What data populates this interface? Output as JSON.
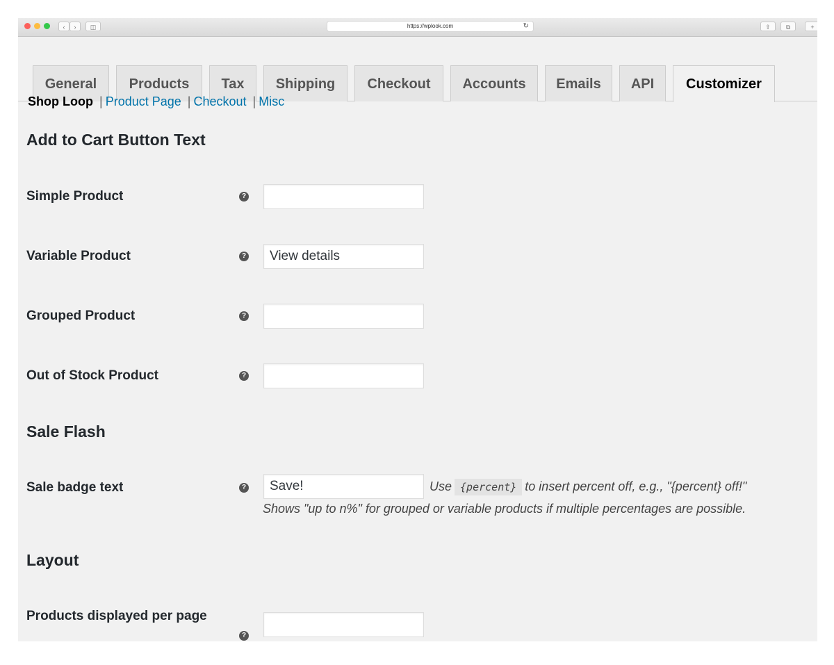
{
  "browser": {
    "url": "https://wplook.com",
    "colors": {
      "close": "#fc605b",
      "minimize": "#fdbc40",
      "zoom": "#34c84a"
    }
  },
  "tabs": [
    {
      "label": "General"
    },
    {
      "label": "Products"
    },
    {
      "label": "Tax"
    },
    {
      "label": "Shipping"
    },
    {
      "label": "Checkout"
    },
    {
      "label": "Accounts"
    },
    {
      "label": "Emails"
    },
    {
      "label": "API"
    },
    {
      "label": "Customizer",
      "active": true
    }
  ],
  "subnav": {
    "current": "Shop Loop",
    "links": [
      "Product Page",
      "Checkout",
      "Misc"
    ],
    "separator": "|"
  },
  "sections": {
    "add_to_cart": {
      "title": "Add to Cart Button Text",
      "fields": [
        {
          "label": "Simple Product",
          "value": ""
        },
        {
          "label": "Variable Product",
          "value": "View details"
        },
        {
          "label": "Grouped Product",
          "value": ""
        },
        {
          "label": "Out of Stock Product",
          "value": ""
        }
      ]
    },
    "sale_flash": {
      "title": "Sale Flash",
      "field": {
        "label": "Sale badge text",
        "value": "Save!",
        "hint_prefix": "Use",
        "hint_code": "{percent}",
        "hint_suffix": "to insert percent off, e.g., \"{percent} off!\"",
        "hint_line2": "Shows \"up to n%\" for grouped or variable products if multiple percentages are possible."
      }
    },
    "layout": {
      "title": "Layout",
      "field": {
        "label": "Products displayed per page",
        "value": ""
      }
    }
  }
}
